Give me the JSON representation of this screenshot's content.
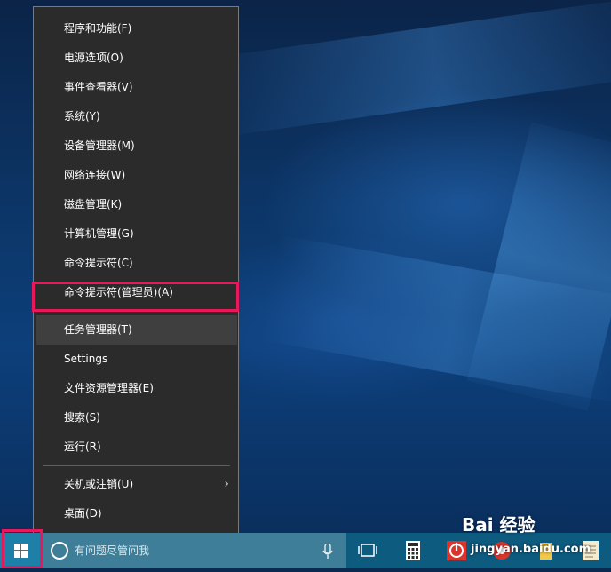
{
  "menu": {
    "items": [
      {
        "label": "程序和功能(F)"
      },
      {
        "label": "电源选项(O)"
      },
      {
        "label": "事件查看器(V)"
      },
      {
        "label": "系统(Y)"
      },
      {
        "label": "设备管理器(M)"
      },
      {
        "label": "网络连接(W)"
      },
      {
        "label": "磁盘管理(K)"
      },
      {
        "label": "计算机管理(G)"
      },
      {
        "label": "命令提示符(C)"
      },
      {
        "label": "命令提示符(管理员)(A)"
      },
      {
        "label": "任务管理器(T)"
      },
      {
        "label": "Settings"
      },
      {
        "label": "文件资源管理器(E)"
      },
      {
        "label": "搜索(S)"
      },
      {
        "label": "运行(R)"
      },
      {
        "label": "关机或注销(U)"
      },
      {
        "label": "桌面(D)"
      }
    ],
    "submenu_chevron": "›"
  },
  "taskbar": {
    "search_placeholder": "有问题尽管问我"
  },
  "watermark": {
    "brand": "Bai 经验",
    "url": "jingyan.baidu.com"
  },
  "colors": {
    "menu_bg": "#2b2b2b",
    "highlight": "#e8185a",
    "taskbar": "#0e5b80"
  }
}
